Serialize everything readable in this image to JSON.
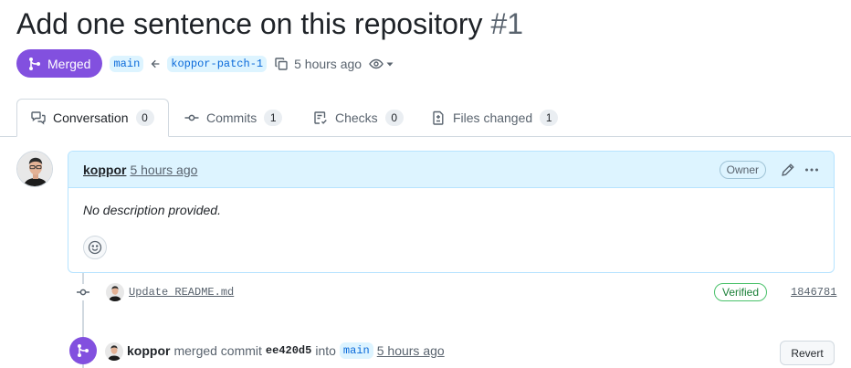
{
  "pr": {
    "title": "Add one sentence on this repository",
    "number": "#1"
  },
  "status": {
    "label": "Merged",
    "base_branch": "main",
    "head_branch": "koppor-patch-1",
    "time": "5 hours ago"
  },
  "tabs": [
    {
      "label": "Conversation",
      "count": "0",
      "icon": "comment-discussion-icon"
    },
    {
      "label": "Commits",
      "count": "1",
      "icon": "git-commit-icon"
    },
    {
      "label": "Checks",
      "count": "0",
      "icon": "checklist-icon"
    },
    {
      "label": "Files changed",
      "count": "1",
      "icon": "file-diff-icon"
    }
  ],
  "comment": {
    "author": "koppor",
    "time": "5 hours ago",
    "role": "Owner",
    "body": "No description provided."
  },
  "commit": {
    "message": "Update README.md",
    "badge": "Verified",
    "sha": "1846781"
  },
  "merge_event": {
    "author": "koppor",
    "text_before": "merged commit",
    "commit_sha": "ee420d5",
    "text_into": "into",
    "branch": "main",
    "time": "5 hours ago",
    "revert_label": "Revert"
  },
  "colors": {
    "merged": "#8250df",
    "accent": "#0969da",
    "verified": "#1a7f37",
    "comment_header": "#ddf4ff"
  }
}
